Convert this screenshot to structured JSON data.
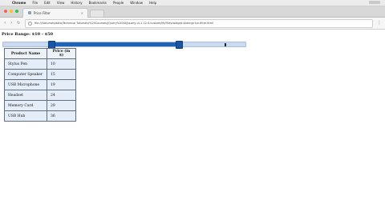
{
  "menubar": {
    "apple": "",
    "items": [
      "Chrome",
      "File",
      "Edit",
      "View",
      "History",
      "Bookmarks",
      "People",
      "Window",
      "Help"
    ]
  },
  "browser": {
    "tab_title": "Price Filter",
    "tab_close": "×",
    "url": "file:///Volumes/data/Technical Tutorials/%20Courses/jQuery%20UI/jquery-ui-1.12.0.custom/MyFiles/widget-slider/price-filter.html",
    "back_icon": "‹",
    "forward_icon": "›",
    "reload_icon": "↻",
    "menu_icon": "⋮"
  },
  "page": {
    "price_label": "Price Range: $10 - $50",
    "slider": {
      "min_fraction": 0.2,
      "max_fraction": 0.73
    }
  },
  "table": {
    "headers": [
      "Product Name",
      "Price (in $)"
    ],
    "rows": [
      [
        "Stylus Pen",
        "10"
      ],
      [
        "Computer Speaker",
        "15"
      ],
      [
        "USB Microphone",
        "19"
      ],
      [
        "Headset",
        "24"
      ],
      [
        "Memory Card",
        "29"
      ],
      [
        "USB Hub",
        "36"
      ]
    ]
  },
  "colors": {
    "slider_range": "#1f63b8",
    "slider_track": "#c9daf2",
    "table_cell": "#e5edf8"
  }
}
